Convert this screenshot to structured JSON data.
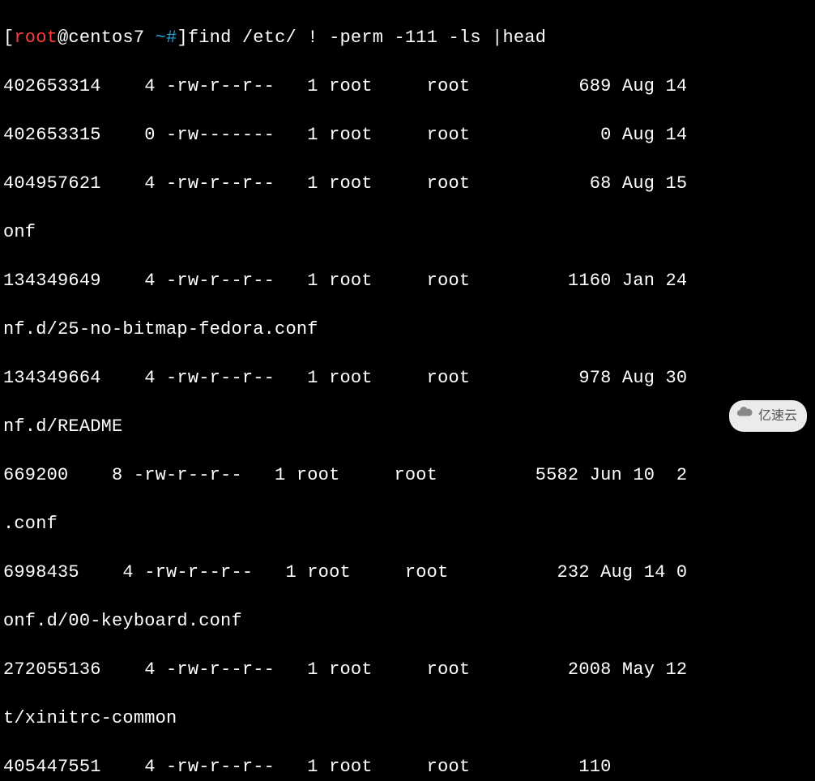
{
  "prompt": {
    "open_bracket": "[",
    "user": "root",
    "at_host": "@centos7",
    "path": " ~#",
    "close_bracket": "]",
    "command": "find /etc/ ! -perm -111 -ls |head"
  },
  "lines": [
    "402653314    4 -rw-r--r--   1 root     root          689 Aug 14",
    "402653315    0 -rw-------   1 root     root            0 Aug 14",
    "404957621    4 -rw-r--r--   1 root     root           68 Aug 15",
    "onf",
    "134349649    4 -rw-r--r--   1 root     root         1160 Jan 24",
    "nf.d/25-no-bitmap-fedora.conf",
    "134349664    4 -rw-r--r--   1 root     root          978 Aug 30",
    "nf.d/README",
    "669200    8 -rw-r--r--   1 root     root         5582 Jun 10  2",
    ".conf",
    "6998435    4 -rw-r--r--   1 root     root          232 Aug 14 0",
    "onf.d/00-keyboard.conf",
    "272055136    4 -rw-r--r--   1 root     root         2008 May 12",
    "t/xinitrc-common",
    "405447551    4 -rw-r--r--   1 root     root          110"
  ],
  "watermark": {
    "text": "亿速云"
  }
}
